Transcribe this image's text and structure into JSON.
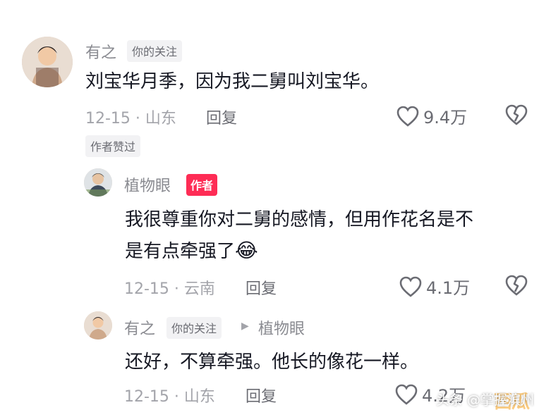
{
  "comments": [
    {
      "username": "有之",
      "follow_tag": "你的关注",
      "content": "刘宝华月季，因为我二舅叫刘宝华。",
      "meta": "12-15 · 山东",
      "reply_label": "回复",
      "like_count": "9.4万",
      "liked_by_author": "作者赞过"
    },
    {
      "username": "植物眼",
      "author_tag": "作者",
      "content_line1": "我很尊重你对二舅的感情，但用作花名是不",
      "content_line2": "是有点牵强了",
      "emoji": "😂",
      "meta": "12-15 · 云南",
      "reply_label": "回复",
      "like_count": "4.1万"
    },
    {
      "username": "有之",
      "follow_tag": "你的关注",
      "reply_arrow": "▶",
      "reply_to": "植物眼",
      "content": "还好，不算牵强。他长的像花一样。",
      "meta": "12-15 · 山东",
      "reply_label": "回复",
      "like_count": "4.2万"
    }
  ],
  "watermark": {
    "text": "头条 @掌握滨州",
    "logo": "西瓜"
  },
  "colors": {
    "accent": "#fe2c55",
    "meta_gray": "#a3a4aa",
    "text": "#161823"
  },
  "icons": [
    "heart-outline-icon",
    "broken-heart-icon",
    "play-arrow-icon"
  ]
}
